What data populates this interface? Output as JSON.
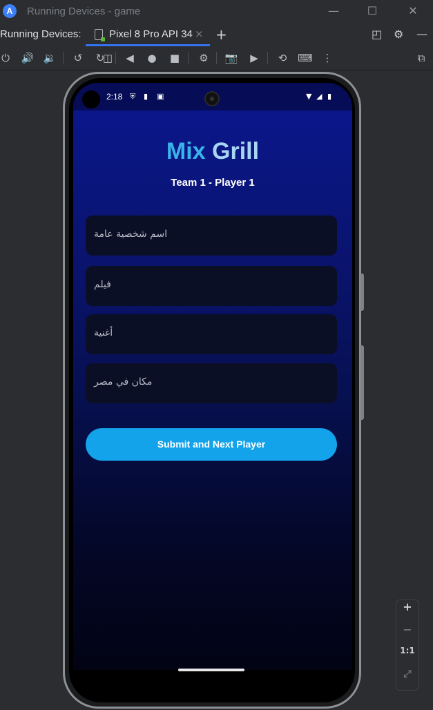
{
  "window": {
    "title": "Running Devices - game",
    "app_icon": "android-studio-icon",
    "minimize": "—",
    "maximize": "☐",
    "close": "✕"
  },
  "tabbar": {
    "label": "Running Devices:",
    "tab_label": "Pixel 8 Pro API 34",
    "tab_close": "×",
    "add": "+",
    "layout_icon": "◰",
    "settings_icon": "⚙",
    "hide_icon": "—"
  },
  "toolbar": {
    "power": "⏻",
    "vol_up": "🔊",
    "vol_down": "🔉",
    "rotate_left": "↺",
    "rotate_right": "↻",
    "fold": "◫",
    "back": "◀",
    "home": "●",
    "overview": "■",
    "device_settings": "⚙",
    "screenshot": "📷",
    "record": "▶",
    "reset": "⟲",
    "keyboard": "⌨",
    "more": "⋮",
    "inspect": "⧉"
  },
  "device": {
    "status": {
      "time": "2:18",
      "icons": [
        "shield-icon",
        "sim-icon",
        "app-notification-icon"
      ],
      "wifi": "▼",
      "signal": "◢",
      "battery": "▮"
    },
    "app": {
      "title_part1": "Mix",
      "title_part2": "Grill",
      "subtitle": "Team 1 - Player 1",
      "fields": [
        {
          "placeholder": "اسم شخصية عامة",
          "value": ""
        },
        {
          "placeholder": "فيلم",
          "value": ""
        },
        {
          "placeholder": "أغنية",
          "value": ""
        },
        {
          "placeholder": "مكان في مصر",
          "value": ""
        }
      ],
      "submit_label": "Submit and Next Player"
    }
  },
  "zoom": {
    "zoom_in": "+",
    "zoom_out": "−",
    "actual_size": "1:1",
    "fit": "⤢"
  },
  "colors": {
    "accent": "#3574f0",
    "title_color": "#3ab3ea",
    "button_color": "#13a3ea",
    "field_bg": "#0a0f25"
  }
}
